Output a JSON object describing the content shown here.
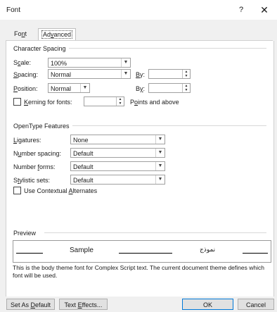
{
  "window": {
    "title": "Font",
    "help": "?",
    "close": "✕"
  },
  "tabs": [
    {
      "label": "Font",
      "underline": "n",
      "active": false
    },
    {
      "label": "Advanced",
      "underline": "v",
      "active": true
    }
  ],
  "character_spacing": {
    "group_label": "Character Spacing",
    "scale_label": "Scale:",
    "scale_value": "100%",
    "spacing_label": "Spacing:",
    "spacing_value": "Normal",
    "by1_label": "By:",
    "by1_value": "",
    "position_label": "Position:",
    "position_value": "Normal",
    "by2_label": "By:",
    "by2_value": "",
    "kerning_label": "Kerning for fonts:",
    "kerning_checked": false,
    "kerning_value": "",
    "points_label": "Points and above"
  },
  "opentype": {
    "group_label": "OpenType Features",
    "ligatures_label": "Ligatures:",
    "ligatures_value": "None",
    "number_spacing_label": "Number spacing:",
    "number_spacing_value": "Default",
    "number_forms_label": "Number forms:",
    "number_forms_value": "Default",
    "stylistic_sets_label": "Stylistic sets:",
    "stylistic_sets_value": "Default",
    "contextual_label": "Use Contextual Alternates",
    "contextual_checked": false
  },
  "preview": {
    "group_label": "Preview",
    "sample": "Sample",
    "sample_arabic": "نموذج",
    "note": "This is the body theme font for Complex Script text. The current document theme defines which font will be used."
  },
  "buttons": {
    "set_default": "Set As Default",
    "text_effects": "Text Effects...",
    "ok": "OK",
    "cancel": "Cancel"
  }
}
